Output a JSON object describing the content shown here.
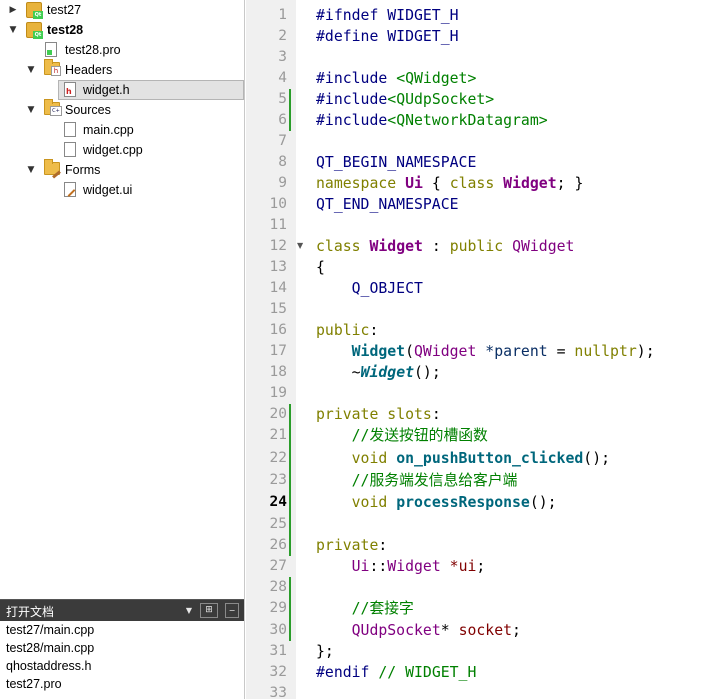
{
  "project_tree": {
    "items": [
      {
        "label": "test27",
        "bold": false,
        "icon": "project-icon",
        "expanded": false
      },
      {
        "label": "test28",
        "bold": true,
        "icon": "project-icon",
        "expanded": true
      },
      {
        "label": "test28.pro",
        "icon": "pro-file-icon"
      },
      {
        "label": "Headers",
        "icon": "headers-folder-icon",
        "expanded": true
      },
      {
        "label": "widget.h",
        "icon": "header-file-icon",
        "selected": true
      },
      {
        "label": "Sources",
        "icon": "sources-folder-icon",
        "expanded": true
      },
      {
        "label": "main.cpp",
        "icon": "cpp-file-icon"
      },
      {
        "label": "widget.cpp",
        "icon": "cpp-file-icon"
      },
      {
        "label": "Forms",
        "icon": "forms-folder-icon",
        "expanded": true
      },
      {
        "label": "widget.ui",
        "icon": "ui-file-icon"
      }
    ]
  },
  "open_documents": {
    "title": "打开文档",
    "split_icon": "split-icon",
    "close_icon": "close-icon",
    "items": [
      "test27/main.cpp",
      "test28/main.cpp",
      "qhostaddress.h",
      "test27.pro"
    ]
  },
  "editor": {
    "current_line": 24,
    "line_numbers": [
      "1",
      "2",
      "3",
      "4",
      "5",
      "6",
      "7",
      "8",
      "9",
      "10",
      "11",
      "12",
      "13",
      "14",
      "15",
      "16",
      "17",
      "18",
      "19",
      "20",
      "21",
      "22",
      "23",
      "24",
      "25",
      "26",
      "27",
      "28",
      "29",
      "30",
      "31",
      "32",
      "33"
    ],
    "code": {
      "l1_a": "#ifndef",
      "l1_b": " WIDGET_H",
      "l2_a": "#define",
      "l2_b": " WIDGET_H",
      "l4_a": "#include",
      "l4_b": " <QWidget>",
      "l5_a": "#include",
      "l5_b": "<QUdpSocket>",
      "l6_a": "#include",
      "l6_b": "<QNetworkDatagram>",
      "l8": "QT_BEGIN_NAMESPACE",
      "l9_a": "namespace",
      "l9_b": "Ui",
      "l9_c": "{",
      "l9_d": "class",
      "l9_e": "Widget",
      "l9_f": "; }",
      "l10": "QT_END_NAMESPACE",
      "l12_a": "class",
      "l12_b": "Widget",
      "l12_c": ":",
      "l12_d": "public",
      "l12_e": "QWidget",
      "l13": "{",
      "l14": "Q_OBJECT",
      "l16_a": "public",
      "l16_b": ":",
      "l17_a": "Widget",
      "l17_b": "(",
      "l17_c": "QWidget",
      "l17_d": "*parent",
      "l17_e": "=",
      "l17_f": "nullptr",
      "l17_g": ");",
      "l18_a": "~",
      "l18_b": "Widget",
      "l18_c": "();",
      "l20_a": "private",
      "l20_b": "slots",
      "l20_c": ":",
      "l21": "//发送按钮的槽函数",
      "l22_a": "void",
      "l22_b": "on_pushButton_clicked",
      "l22_c": "();",
      "l23": "//服务端发信息给客户端",
      "l24_a": "void",
      "l24_b": "processResponse",
      "l24_c": "();",
      "l26_a": "private",
      "l26_b": ":",
      "l27_a": "Ui",
      "l27_b": "::",
      "l27_c": "Widget",
      "l27_d": "*ui",
      "l27_e": ";",
      "l29": "//套接字",
      "l30_a": "QUdpSocket",
      "l30_b": "*",
      "l30_c": "socket",
      "l30_d": ";",
      "l31": "};",
      "l32_a": "#endif",
      "l32_b": "// WIDGET_H"
    }
  },
  "colors": {
    "preprocessor": "#000080",
    "include_path": "#008000",
    "keyword": "#808000",
    "type": "#800080",
    "function": "#00677c",
    "comment": "#008000",
    "modified_marker": "#2a9d2a"
  }
}
